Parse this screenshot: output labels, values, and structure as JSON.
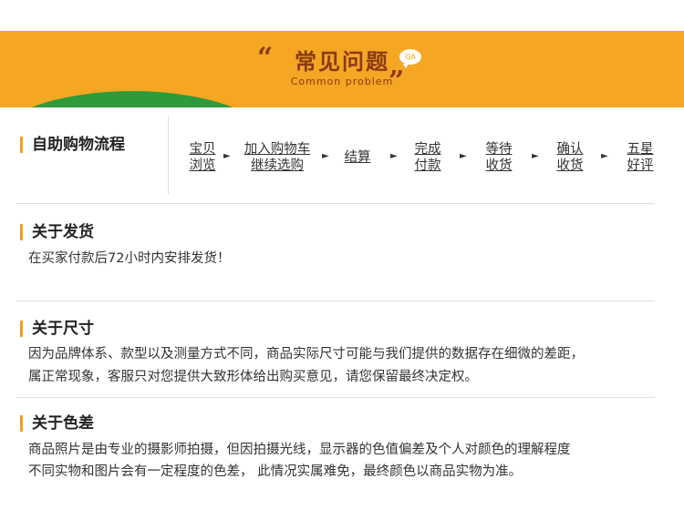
{
  "banner": {
    "title": "常见问题",
    "subtitle": "Common problem",
    "badge": "QA",
    "quote_open": "“",
    "quote_close": "”"
  },
  "flow": {
    "title": "自助购物流程",
    "steps": [
      {
        "line1": "宝贝",
        "line2": "浏览"
      },
      {
        "line1": "加入购物车",
        "line2": "继续选购"
      },
      {
        "line1": "结算",
        "line2": ""
      },
      {
        "line1": "完成",
        "line2": "付款"
      },
      {
        "line1": "等待",
        "line2": "收货"
      },
      {
        "line1": "确认",
        "line2": "收货"
      },
      {
        "line1": "五星",
        "line2": "好评"
      }
    ],
    "arrow": "►"
  },
  "shipping": {
    "title": "关于发货",
    "text": "在买家付款后72小时内安排发货！"
  },
  "size": {
    "title": "关于尺寸",
    "line1": "因为品牌体系、款型以及测量方式不同，商品实际尺寸可能与我们提供的数据存在细微的差距，",
    "line2": "属正常现象，客服只对您提供大致形体给出购买意见，请您保留最终决定权。"
  },
  "color": {
    "title": "关于色差",
    "line1": "商品照片是由专业的摄影师拍摄，但因拍摄光线，显示器的色值偏差及个人对颜色的理解程度",
    "line2": "不同实物和图片会有一定程度的色差， 此情况实属难免，最终颜色以商品实物为准。"
  },
  "colors": {
    "banner": "#f5a623",
    "hill": "#2f9a3a",
    "title": "#8a3b12",
    "accent_bar": "#f0a020"
  }
}
